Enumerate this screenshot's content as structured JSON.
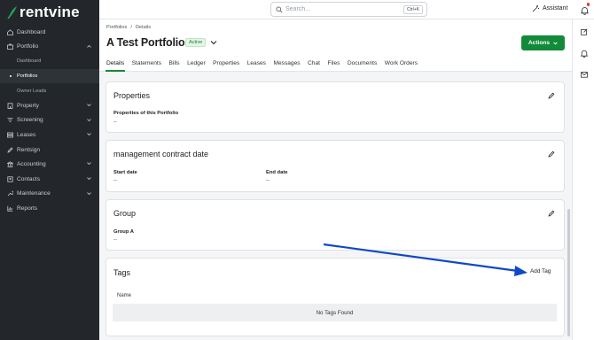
{
  "brand": {
    "name": "rentvine",
    "accent": "#128a3a"
  },
  "sidebar": {
    "items": [
      {
        "label": "Dashboard",
        "icon": "home-icon"
      },
      {
        "label": "Portfolio",
        "icon": "briefcase-icon",
        "expanded": true
      },
      {
        "label": "Dashboard",
        "sub": true
      },
      {
        "label": "Portfolios",
        "sub": true,
        "active": true
      },
      {
        "label": "Owner Leads",
        "sub": true
      },
      {
        "label": "Property",
        "icon": "building-icon",
        "chevron": true
      },
      {
        "label": "Screening",
        "icon": "filter-icon",
        "chevron": true
      },
      {
        "label": "Leases",
        "icon": "stack-icon",
        "chevron": true
      },
      {
        "label": "Rentsign",
        "icon": "pen-icon"
      },
      {
        "label": "Accounting",
        "icon": "bank-icon",
        "chevron": true
      },
      {
        "label": "Contacts",
        "icon": "contacts-icon",
        "chevron": true
      },
      {
        "label": "Maintenance",
        "icon": "wrench-icon",
        "chevron": true
      },
      {
        "label": "Reports",
        "icon": "chart-icon"
      }
    ]
  },
  "topbar": {
    "search_placeholder": "Search...",
    "shortcut": "Ctrl+K",
    "assistant_label": "Assistant"
  },
  "header": {
    "breadcrumb": [
      "Portfolios",
      "/",
      "Details"
    ],
    "title": "A Test Portfolio",
    "status": "Active",
    "actions_label": "Actions",
    "tabs": [
      "Details",
      "Statements",
      "Bills",
      "Ledger",
      "Properties",
      "Leases",
      "Messages",
      "Chat",
      "Files",
      "Documents",
      "Work Orders"
    ],
    "active_tab": "Details"
  },
  "cards": {
    "properties": {
      "title": "Properties",
      "field_label": "Properties of this Portfolio",
      "field_value": "--"
    },
    "contract": {
      "title": "management contract date",
      "start_label": "Start date",
      "start_value": "--",
      "end_label": "End date",
      "end_value": "--"
    },
    "group": {
      "title": "Group",
      "field_label": "Group A",
      "field_value": "--"
    },
    "tags": {
      "title": "Tags",
      "add_label": "Add Tag",
      "column": "Name",
      "empty": "No Tags Found"
    }
  },
  "annotation": {
    "arrow_color": "#1048c8"
  }
}
